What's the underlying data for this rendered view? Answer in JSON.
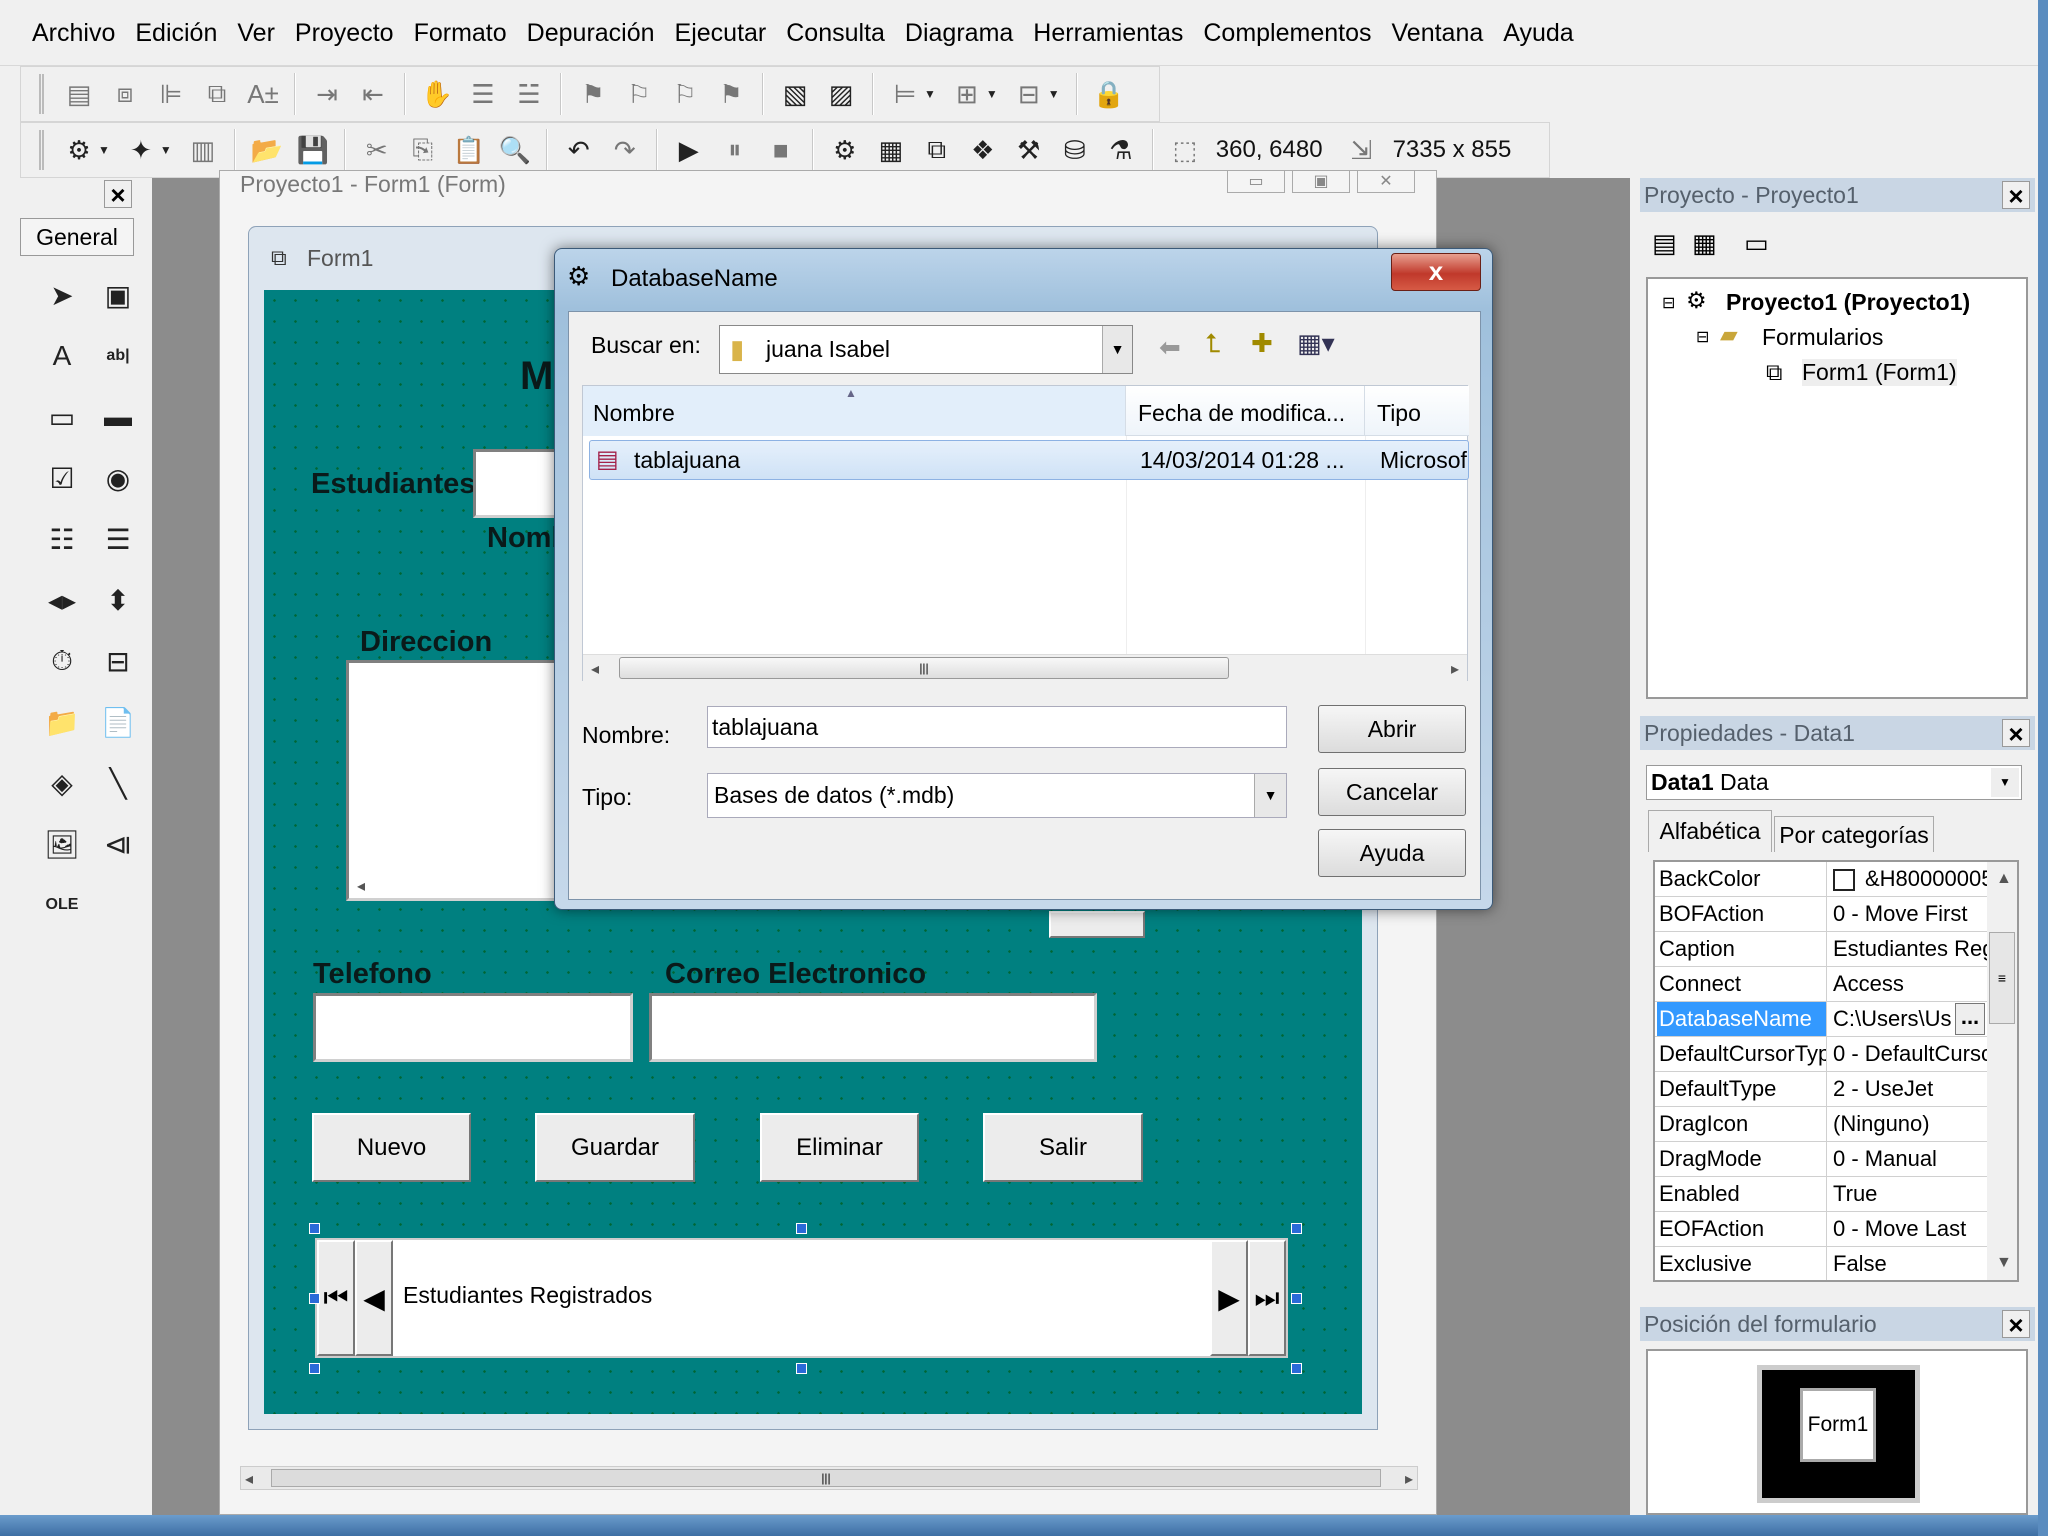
{
  "menu": [
    "Archivo",
    "Edición",
    "Ver",
    "Proyecto",
    "Formato",
    "Depuración",
    "Ejecutar",
    "Consulta",
    "Diagrama",
    "Herramientas",
    "Complementos",
    "Ventana",
    "Ayuda"
  ],
  "toolbar1": [
    {
      "icon": "form-editor-icon",
      "g": "▤"
    },
    {
      "icon": "bring-to-front-icon",
      "g": "⧈"
    },
    {
      "icon": "align-lefts-icon",
      "g": "⊫"
    },
    {
      "icon": "center-icon",
      "g": "⧉"
    },
    {
      "icon": "font-size-icon",
      "g": "A±"
    },
    {
      "sep": true
    },
    {
      "icon": "indent-icon",
      "g": "⇥"
    },
    {
      "icon": "outdent-icon",
      "g": "⇤"
    },
    {
      "sep": true
    },
    {
      "icon": "hand-icon",
      "g": "✋"
    },
    {
      "icon": "comment-block-icon",
      "g": "☰"
    },
    {
      "icon": "uncomment-block-icon",
      "g": "☱"
    },
    {
      "sep": true
    },
    {
      "icon": "toggle-bookmark-icon",
      "g": "⚑"
    },
    {
      "icon": "next-bookmark-icon",
      "g": "⚐"
    },
    {
      "icon": "previous-bookmark-icon",
      "g": "⚐"
    },
    {
      "icon": "clear-bookmarks-icon",
      "g": "⚑"
    },
    {
      "sep": true
    },
    {
      "icon": "bring-front-icon",
      "g": "▧",
      "col": true
    },
    {
      "icon": "send-back-icon",
      "g": "▨",
      "col": true
    },
    {
      "sep": true
    },
    {
      "icon": "align-icon",
      "g": "⊨",
      "dd": true
    },
    {
      "icon": "center-align-icon",
      "g": "⊞",
      "dd": true
    },
    {
      "icon": "size-icon",
      "g": "⊟",
      "dd": true
    },
    {
      "sep": true
    },
    {
      "icon": "lock-controls-icon",
      "g": "🔒"
    }
  ],
  "toolbar2": [
    {
      "icon": "add-project-icon",
      "g": "⚙",
      "col": true,
      "dd": true
    },
    {
      "icon": "add-form-icon",
      "g": "✦",
      "col": true,
      "dd": true
    },
    {
      "icon": "menu-editor-icon",
      "g": "▥"
    },
    {
      "sep": true
    },
    {
      "icon": "open-project-icon",
      "g": "📂",
      "col": true
    },
    {
      "icon": "save-project-icon",
      "g": "💾",
      "col": true
    },
    {
      "sep": true
    },
    {
      "icon": "cut-icon",
      "g": "✂"
    },
    {
      "icon": "copy-icon",
      "g": "⎘"
    },
    {
      "icon": "paste-icon",
      "g": "📋"
    },
    {
      "icon": "find-icon",
      "g": "🔍"
    },
    {
      "sep": true
    },
    {
      "icon": "undo-icon",
      "g": "↶",
      "col": true
    },
    {
      "icon": "redo-icon",
      "g": "↷"
    },
    {
      "sep": true
    },
    {
      "icon": "start-icon",
      "g": "▶",
      "col": true
    },
    {
      "icon": "break-icon",
      "g": "⏸"
    },
    {
      "icon": "end-icon",
      "g": "■"
    },
    {
      "sep": true
    },
    {
      "icon": "project-explorer-icon",
      "g": "⚙",
      "col": true
    },
    {
      "icon": "properties-window-icon",
      "g": "▦",
      "col": true
    },
    {
      "icon": "form-layout-icon",
      "g": "⧉",
      "col": true
    },
    {
      "icon": "object-browser-icon",
      "g": "❖",
      "col": true
    },
    {
      "icon": "toolbox-icon",
      "g": "⚒",
      "col": true
    },
    {
      "icon": "data-view-icon",
      "g": "⛁",
      "col": true
    },
    {
      "icon": "component-manager-icon",
      "g": "⚗",
      "col": true
    }
  ],
  "position": {
    "icon": "position-icon",
    "value": "360, 6480"
  },
  "size": {
    "icon": "size-readout-icon",
    "value": "7335 x 855"
  },
  "toolbox": {
    "title": "General",
    "tools": [
      {
        "name": "pointer",
        "g": "➤"
      },
      {
        "name": "picturebox",
        "g": "▣"
      },
      {
        "name": "label",
        "g": "A"
      },
      {
        "name": "textbox",
        "g": "ab|"
      },
      {
        "name": "frame",
        "g": "▭"
      },
      {
        "name": "commandbutton",
        "g": "▬"
      },
      {
        "name": "checkbox",
        "g": "☑"
      },
      {
        "name": "optionbutton",
        "g": "◉"
      },
      {
        "name": "combobox",
        "g": "☷"
      },
      {
        "name": "listbox",
        "g": "☰"
      },
      {
        "name": "hscrollbar",
        "g": "◂▸"
      },
      {
        "name": "vscrollbar",
        "g": "⬍"
      },
      {
        "name": "timer",
        "g": "⏱"
      },
      {
        "name": "drivelistbox",
        "g": "⊟"
      },
      {
        "name": "dirlistbox",
        "g": "📁"
      },
      {
        "name": "filelistbox",
        "g": "📄"
      },
      {
        "name": "shape",
        "g": "◈"
      },
      {
        "name": "line",
        "g": "╲"
      },
      {
        "name": "image",
        "g": "🖼"
      },
      {
        "name": "data",
        "g": "⧏"
      },
      {
        "name": "ole",
        "g": "OLE"
      }
    ]
  },
  "designer": {
    "title": "Proyecto1 - Form1 (Form)"
  },
  "form": {
    "title": "Form1",
    "heading": "M",
    "estudiantes": "Estudiantes",
    "nombre": "Nomb",
    "direccion": "Direccion",
    "telefono": "Telefono",
    "correo": "Correo Electronico",
    "buttons": {
      "nuevo": "Nuevo",
      "guardar": "Guardar",
      "eliminar": "Eliminar",
      "salir": "Salir"
    },
    "data_caption": "Estudiantes Registrados"
  },
  "dialog": {
    "title": "DatabaseName",
    "close": "x",
    "lookin_label": "Buscar en:",
    "lookin_value": "juana Isabel",
    "columns": [
      "Nombre",
      "Fecha de modifica...",
      "Tipo"
    ],
    "files": [
      {
        "name": "tablajuana",
        "date": "14/03/2014 01:28 ...",
        "type": "Microsof"
      }
    ],
    "filename_label": "Nombre:",
    "filename_value": "tablajuana",
    "type_label": "Tipo:",
    "type_value": "Bases de datos (*.mdb)",
    "open": "Abrir",
    "cancel": "Cancelar",
    "help": "Ayuda"
  },
  "project": {
    "title": "Proyecto - Proyecto1",
    "root": "Proyecto1 (Proyecto1)",
    "folder": "Formularios",
    "item": "Form1 (Form1)"
  },
  "properties": {
    "title": "Propiedades - Data1",
    "object_name": "Data1",
    "object_type": "Data",
    "tabs": [
      "Alfabética",
      "Por categorías"
    ],
    "rows": [
      {
        "name": "BackColor",
        "value": "&H80000005"
      },
      {
        "name": "BOFAction",
        "value": "0 - Move First"
      },
      {
        "name": "Caption",
        "value": "Estudiantes Reg"
      },
      {
        "name": "Connect",
        "value": "Access"
      },
      {
        "name": "DatabaseName",
        "value": "C:\\Users\\Us",
        "selected": true
      },
      {
        "name": "DefaultCursorTyp",
        "value": "0 - DefaultCursc"
      },
      {
        "name": "DefaultType",
        "value": "2 - UseJet"
      },
      {
        "name": "DragIcon",
        "value": "(Ninguno)"
      },
      {
        "name": "DragMode",
        "value": "0 - Manual"
      },
      {
        "name": "Enabled",
        "value": "True"
      },
      {
        "name": "EOFAction",
        "value": "0 - Move Last"
      },
      {
        "name": "Exclusive",
        "value": "False"
      }
    ],
    "ellipsis": "..."
  },
  "layout_panel": {
    "title": "Posición del formulario",
    "form_label": "Form1"
  },
  "colors": {
    "teal": "#008080",
    "selection": "#3399ff"
  }
}
